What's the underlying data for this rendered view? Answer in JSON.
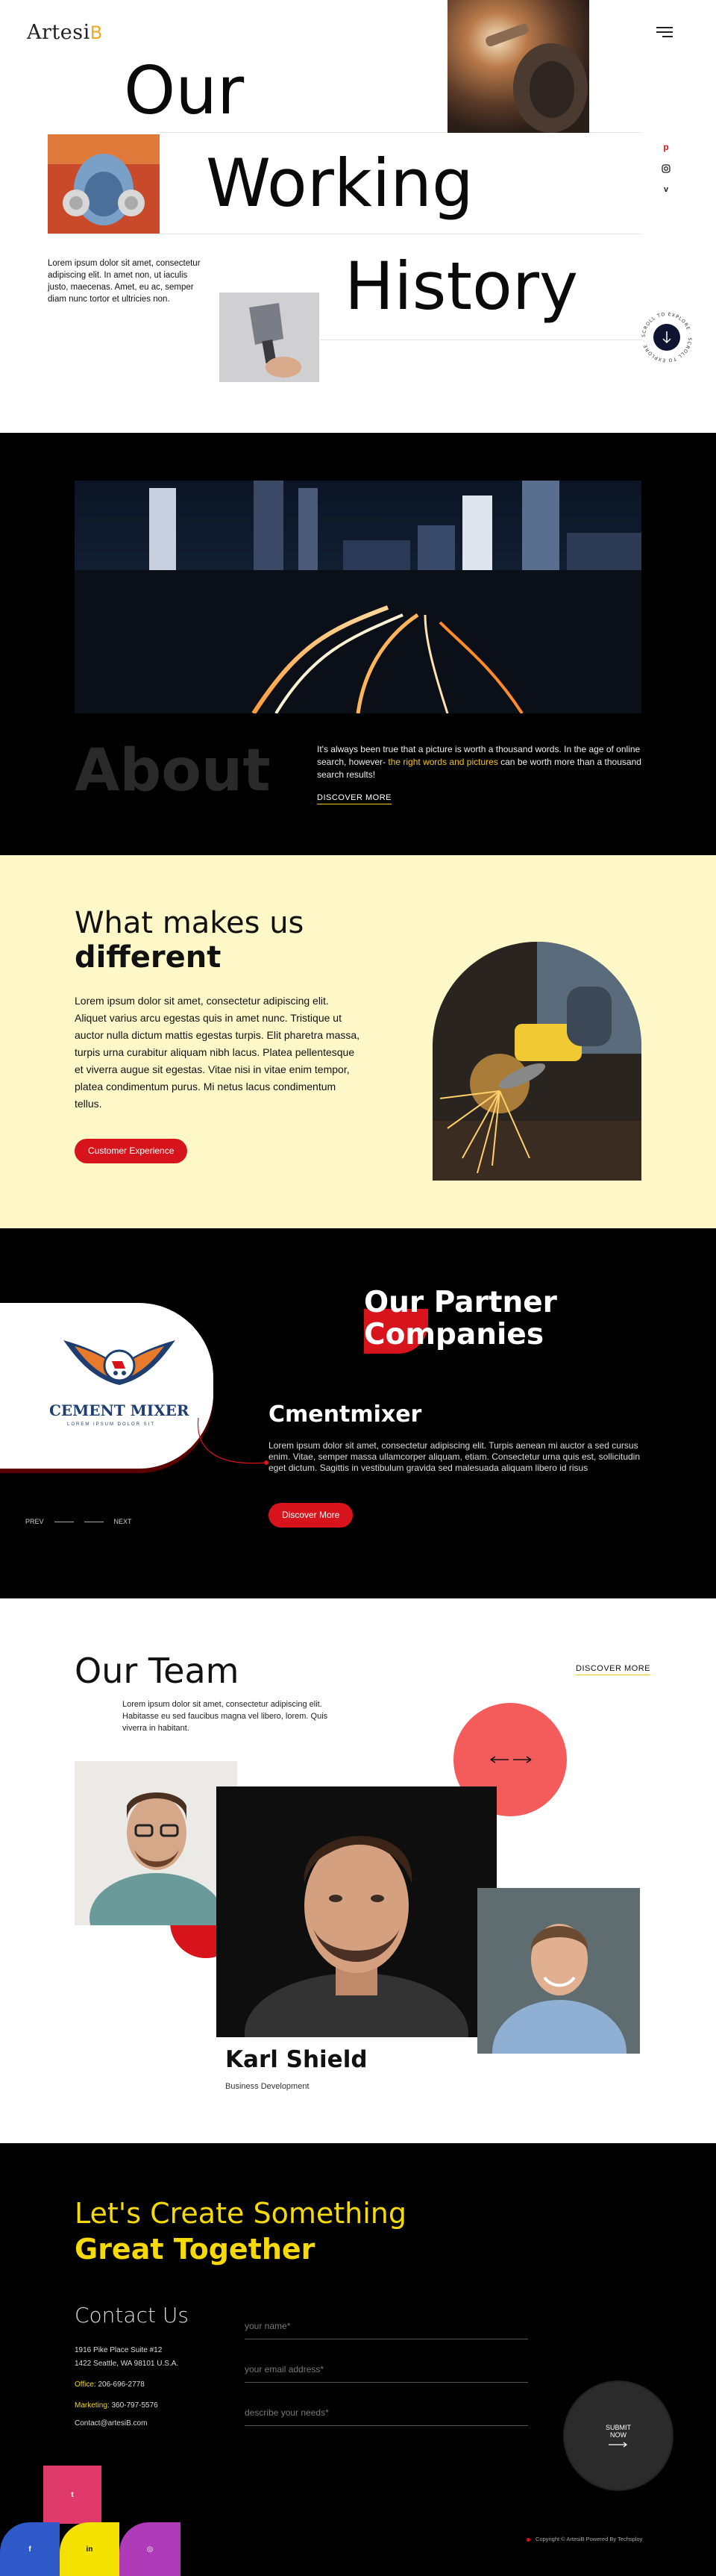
{
  "brand": {
    "logo_text": "Artesi",
    "logo_accent": "B",
    "accent": "#d7141b",
    "yellow": "#f5c518"
  },
  "hero": {
    "word1": "Our",
    "word2": "Working",
    "word3": "History",
    "intro": "Lorem ipsum dolor sit amet, consectetur adipiscing elit. In amet non, ut iaculis justo, maecenas. Amet, eu ac, semper diam nunc tortor et ultricies non.",
    "scroll_label": "SCROLL TO EXPLORE · SCROLL TO EXPLORE ·",
    "social_icons": [
      "pinterest-icon",
      "instagram-icon",
      "vimeo-icon"
    ]
  },
  "about": {
    "heading": "About",
    "text_before": "It's always been true that a picture is worth a thousand words. In the age of online search, however-",
    "text_highlight": " the right words and pictures",
    "text_after": " can be worth more than a thousand search results!",
    "link": "DISCOVER MORE"
  },
  "different": {
    "heading_light": "What makes us",
    "heading_bold": "different",
    "body": "Lorem ipsum dolor sit amet, consectetur adipiscing elit. Aliquet varius arcu egestas quis in amet nunc. Tristique ut auctor nulla dictum mattis egestas turpis. Elit pharetra massa, turpis urna curabitur aliquam nibh lacus. Platea pellentesque et viverra augue sit egestas. Vitae nisi in vitae enim tempor, platea condimentum purus. Mi netus lacus condimentum tellus.",
    "button": "Customer Experience"
  },
  "partners": {
    "heading_line1": "Our Partner",
    "heading_line2": "Companies",
    "logo_title": "CEMENT MIXER",
    "logo_sub": "LOREM IPSUM DOLOR SIT",
    "company": "Cmentmixer",
    "body": "Lorem ipsum dolor sit amet, consectetur adipiscing elit. Turpis aenean mi auctor a sed cursus enim. Vitae, semper massa ullamcorper aliquam, etiam. Consectetur urna quis est, sollicitudin eget dictum. Sagittis in vestibulum gravida sed malesuada aliquam libero id risus",
    "button": "Discover More",
    "prev": "PREV",
    "next": "NEXT"
  },
  "team": {
    "heading": "Our Team",
    "intro": "Lorem ipsum dolor sit amet, consectetur adipiscing elit. Habitasse eu sed faucibus magna vel libero, lorem. Quis viverra in habitant.",
    "link": "DISCOVER MORE",
    "member_name": "Karl Shield",
    "member_role": "Business Development"
  },
  "contact": {
    "heading_light": "Let's Create Something",
    "heading_bold": "Great Together",
    "subheading": "Contact Us",
    "address1": "1916 Pike Place Suite #12",
    "address2": "1422 Seattle, WA 98101 U.S.A.",
    "office_label": "Office:",
    "office_phone": "206-696-2778",
    "marketing_label": "Marketing:",
    "marketing_phone": "360-797-5576",
    "email": "Contact@artesiB.com",
    "name_placeholder": "your name*",
    "email_placeholder": "your email address*",
    "needs_placeholder": "describe your needs*",
    "submit_line1": "SUBMIT",
    "submit_line2": "NOW",
    "copyright": "Copyright © ArtesiB Powered By Techsploy",
    "share_buttons": [
      {
        "icon": "twitter-icon",
        "label": "t",
        "color": "#e03a6c"
      },
      {
        "icon": "facebook-icon",
        "label": "f",
        "color": "#2f58c9"
      },
      {
        "icon": "linkedin-icon",
        "label": "in",
        "color": "#f5e100"
      },
      {
        "icon": "instagram-icon",
        "label": "◎",
        "color": "#b03bb8"
      }
    ]
  }
}
